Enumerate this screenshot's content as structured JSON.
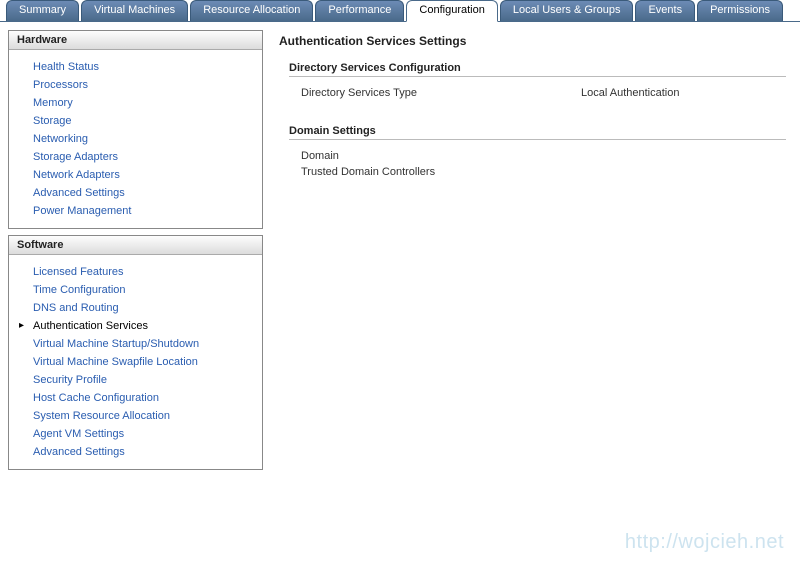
{
  "tabs": [
    {
      "label": "Summary",
      "active": false
    },
    {
      "label": "Virtual Machines",
      "active": false
    },
    {
      "label": "Resource Allocation",
      "active": false
    },
    {
      "label": "Performance",
      "active": false
    },
    {
      "label": "Configuration",
      "active": true
    },
    {
      "label": "Local Users & Groups",
      "active": false
    },
    {
      "label": "Events",
      "active": false
    },
    {
      "label": "Permissions",
      "active": false
    }
  ],
  "sidebar": {
    "hardware": {
      "title": "Hardware",
      "items": [
        "Health Status",
        "Processors",
        "Memory",
        "Storage",
        "Networking",
        "Storage Adapters",
        "Network Adapters",
        "Advanced Settings",
        "Power Management"
      ]
    },
    "software": {
      "title": "Software",
      "items": [
        "Licensed Features",
        "Time Configuration",
        "DNS and Routing",
        "Authentication Services",
        "Virtual Machine Startup/Shutdown",
        "Virtual Machine Swapfile Location",
        "Security Profile",
        "Host Cache Configuration",
        "System Resource Allocation",
        "Agent VM Settings",
        "Advanced Settings"
      ],
      "activeIndex": 3
    }
  },
  "content": {
    "title": "Authentication Services Settings",
    "sections": [
      {
        "header": "Directory Services Configuration",
        "rows": [
          {
            "label": "Directory Services Type",
            "value": "Local Authentication"
          }
        ]
      },
      {
        "header": "Domain Settings",
        "rows": [
          {
            "label": "Domain",
            "value": ""
          },
          {
            "label": "Trusted Domain Controllers",
            "value": ""
          }
        ]
      }
    ]
  },
  "watermark": "http://wojcieh.net"
}
